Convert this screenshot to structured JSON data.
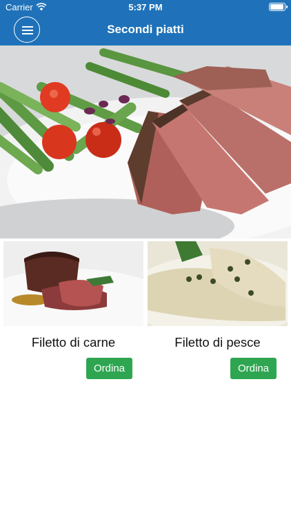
{
  "status_bar": {
    "carrier": "Carrier",
    "time": "5:37 PM"
  },
  "header": {
    "title": "Secondi piatti",
    "menu_icon": "hamburger-menu-icon",
    "background_color": "#1f72b9"
  },
  "hero": {
    "image": "grilled-tuna-steak-with-asparagus-and-cherry-tomatoes"
  },
  "dishes": [
    {
      "name": "Filetto di carne",
      "button_label": "Ordina",
      "image": "beef-fillet-photo"
    },
    {
      "name": "Filetto di pesce",
      "button_label": "Ordina",
      "image": "fish-fillet-with-capers-photo"
    }
  ],
  "colors": {
    "header": "#1f72b9",
    "order_button": "#2ea651",
    "background": "#ffffff"
  }
}
